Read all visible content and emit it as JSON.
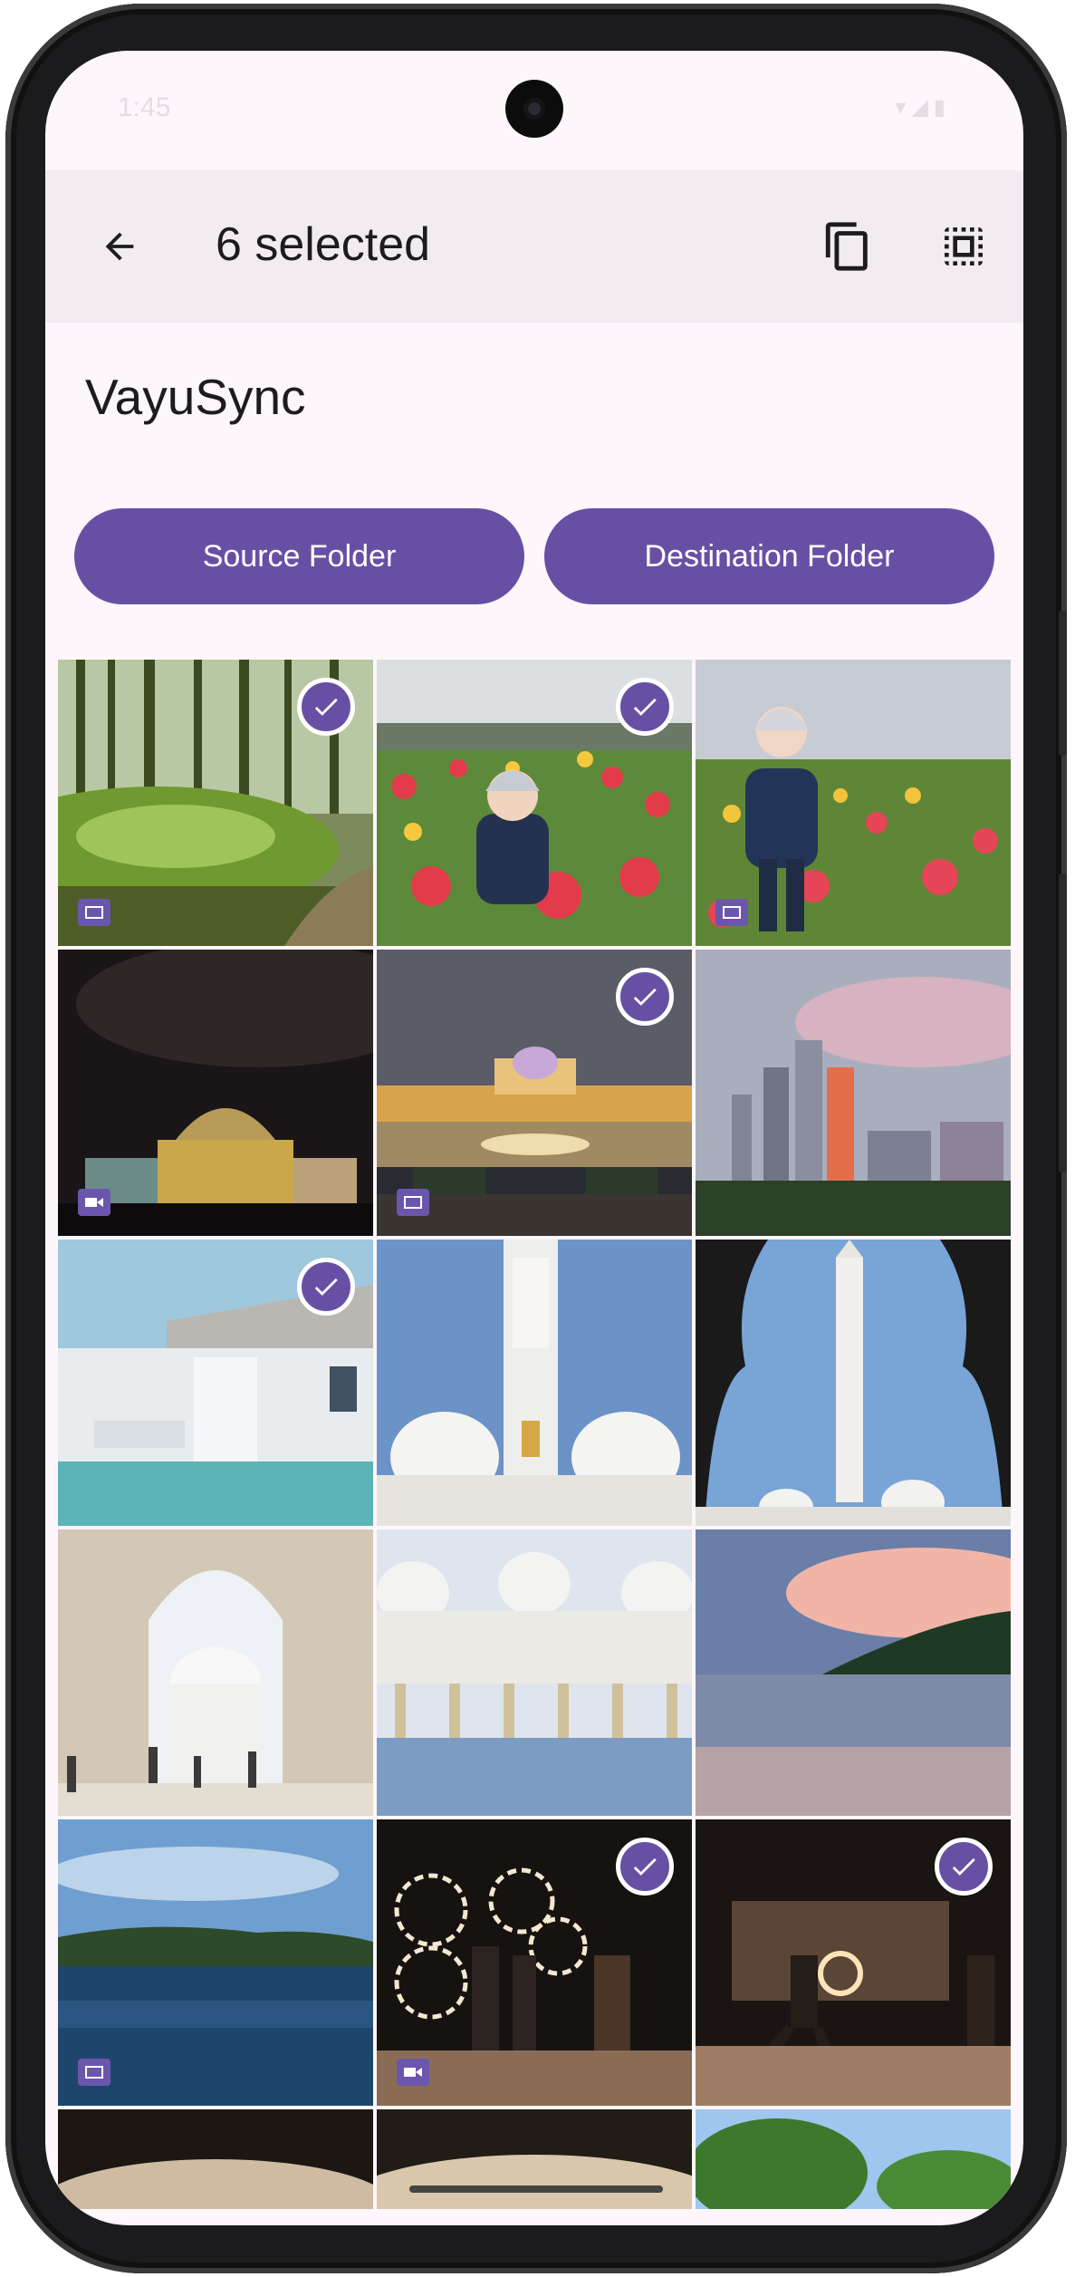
{
  "status": {
    "time": "1:45"
  },
  "appbar": {
    "title": "6 selected"
  },
  "app_name": "VayuSync",
  "buttons": {
    "source": "Source Folder",
    "destination": "Destination Folder"
  },
  "colors": {
    "accent": "#6750a4",
    "background": "#fdf6fb",
    "appbar": "#f2ecf2"
  },
  "icons": {
    "back": "arrow-left-icon",
    "copy": "copy-icon",
    "select_all": "select-all-icon",
    "check": "check-circle-icon",
    "image": "image-badge-icon",
    "video": "video-badge-icon"
  },
  "photos": [
    {
      "name": "forest-grass",
      "selected": true,
      "badge": "image"
    },
    {
      "name": "child-tulips-1",
      "selected": true,
      "badge": "none"
    },
    {
      "name": "child-tulips-2",
      "selected": false,
      "badge": "image"
    },
    {
      "name": "palace-night",
      "selected": false,
      "badge": "video"
    },
    {
      "name": "palace-dusk",
      "selected": true,
      "badge": "image"
    },
    {
      "name": "city-fog",
      "selected": false,
      "badge": "none"
    },
    {
      "name": "white-museum",
      "selected": true,
      "badge": "none"
    },
    {
      "name": "mosque-minaret",
      "selected": false,
      "badge": "none"
    },
    {
      "name": "minaret-arch",
      "selected": false,
      "badge": "none"
    },
    {
      "name": "mosque-arch-interior",
      "selected": false,
      "badge": "none"
    },
    {
      "name": "mosque-courtyard",
      "selected": false,
      "badge": "none"
    },
    {
      "name": "beach-sunset",
      "selected": false,
      "badge": "none"
    },
    {
      "name": "sea-island",
      "selected": false,
      "badge": "image"
    },
    {
      "name": "fire-dancers",
      "selected": true,
      "badge": "video"
    },
    {
      "name": "fire-performer",
      "selected": true,
      "badge": "none"
    },
    {
      "name": "sand-closeup-1",
      "selected": false,
      "badge": "none"
    },
    {
      "name": "sand-closeup-2",
      "selected": false,
      "badge": "none"
    },
    {
      "name": "tropical-trees",
      "selected": false,
      "badge": "none"
    }
  ]
}
